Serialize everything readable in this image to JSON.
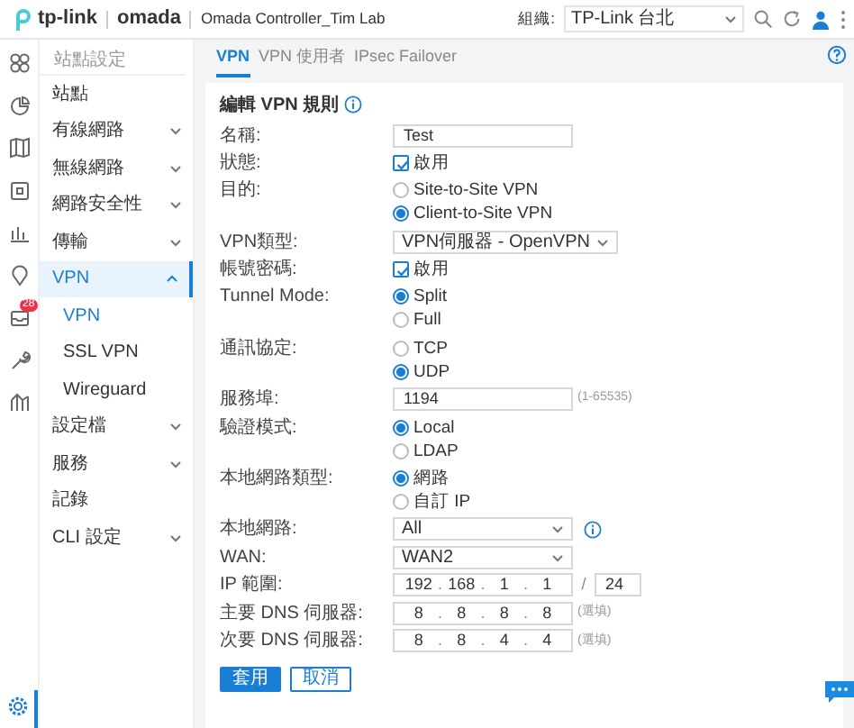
{
  "header": {
    "brand": "tp-link",
    "product": "omada",
    "controller": "Omada Controller_Tim Lab",
    "org_label": "組織:",
    "org_value": "TP-Link 台北"
  },
  "rail": {
    "alerts_badge": "28",
    "settings_selected": true
  },
  "sidebar": {
    "title": "站點設定",
    "items": [
      {
        "label": "站點",
        "selected": false
      },
      {
        "label": "有線網路",
        "selected": false,
        "expanded": false
      },
      {
        "label": "無線網路",
        "selected": false,
        "expanded": false
      },
      {
        "label": "網路安全性",
        "selected": false,
        "expanded": false
      },
      {
        "label": "傳輸",
        "selected": false,
        "expanded": false
      },
      {
        "label": "VPN",
        "selected": true,
        "expanded": true,
        "children": [
          {
            "label": "VPN",
            "selected": true
          },
          {
            "label": "SSL VPN",
            "selected": false
          },
          {
            "label": "Wireguard",
            "selected": false
          }
        ]
      },
      {
        "label": "設定檔",
        "selected": false,
        "expanded": false
      },
      {
        "label": "服務",
        "selected": false,
        "expanded": false
      },
      {
        "label": "記錄",
        "selected": false
      },
      {
        "label": "CLI 設定",
        "selected": false,
        "expanded": false
      }
    ]
  },
  "tabs": [
    {
      "label": "VPN",
      "selected": true
    },
    {
      "label": "VPN 使用者",
      "selected": false
    },
    {
      "label": "IPsec Failover",
      "selected": false
    }
  ],
  "form": {
    "title": "編輯 VPN 規則",
    "rows": [
      {
        "kind": "text",
        "label": "名稱:",
        "value": "Test"
      },
      {
        "kind": "checkbox",
        "label": "狀態:",
        "option": "啟用",
        "checked": true
      },
      {
        "kind": "radio",
        "label": "目的:",
        "options": [
          {
            "label": "Site-to-Site VPN",
            "selected": false
          },
          {
            "label": "Client-to-Site VPN",
            "selected": true
          }
        ]
      },
      {
        "kind": "select",
        "label": "VPN類型:",
        "value": "VPN伺服器 - OpenVPN"
      },
      {
        "kind": "checkbox",
        "label": "帳號密碼:",
        "option": "啟用",
        "checked": true
      },
      {
        "kind": "radio",
        "label": "Tunnel Mode:",
        "options": [
          {
            "label": "Split",
            "selected": true
          },
          {
            "label": "Full",
            "selected": false
          }
        ]
      },
      {
        "kind": "radio",
        "label": "通訊協定:",
        "options": [
          {
            "label": "TCP",
            "selected": false
          },
          {
            "label": "UDP",
            "selected": true
          }
        ]
      },
      {
        "kind": "text",
        "label": "服務埠:",
        "value": "1194",
        "hint": "(1-65535)"
      },
      {
        "kind": "radio",
        "label": "驗證模式:",
        "options": [
          {
            "label": "Local",
            "selected": true
          },
          {
            "label": "LDAP",
            "selected": false
          }
        ]
      },
      {
        "kind": "radio",
        "label": "本地網路類型:",
        "options": [
          {
            "label": "網路",
            "selected": true
          },
          {
            "label": "自訂 IP",
            "selected": false
          }
        ]
      },
      {
        "kind": "select",
        "label": "本地網路:",
        "value": "All",
        "info": true
      },
      {
        "kind": "select",
        "label": "WAN:",
        "value": "WAN2"
      },
      {
        "kind": "ip",
        "label": "IP 範圍:",
        "parts": [
          "192",
          ".",
          "168",
          ".",
          "1",
          ".",
          "1"
        ],
        "slash": "/",
        "prefix": "24"
      },
      {
        "kind": "ip",
        "label": "主要 DNS 伺服器:",
        "parts": [
          "8",
          ".",
          "8",
          ".",
          "8",
          ".",
          "8"
        ],
        "hint": "(選填)"
      },
      {
        "kind": "ip",
        "label": "次要 DNS 伺服器:",
        "parts": [
          "8",
          ".",
          "8",
          ".",
          "4",
          ".",
          "4"
        ],
        "hint": "(選填)"
      }
    ],
    "buttons": [
      {
        "label": "套用",
        "kind": "primary"
      },
      {
        "label": "取消",
        "kind": "secondary"
      }
    ]
  }
}
